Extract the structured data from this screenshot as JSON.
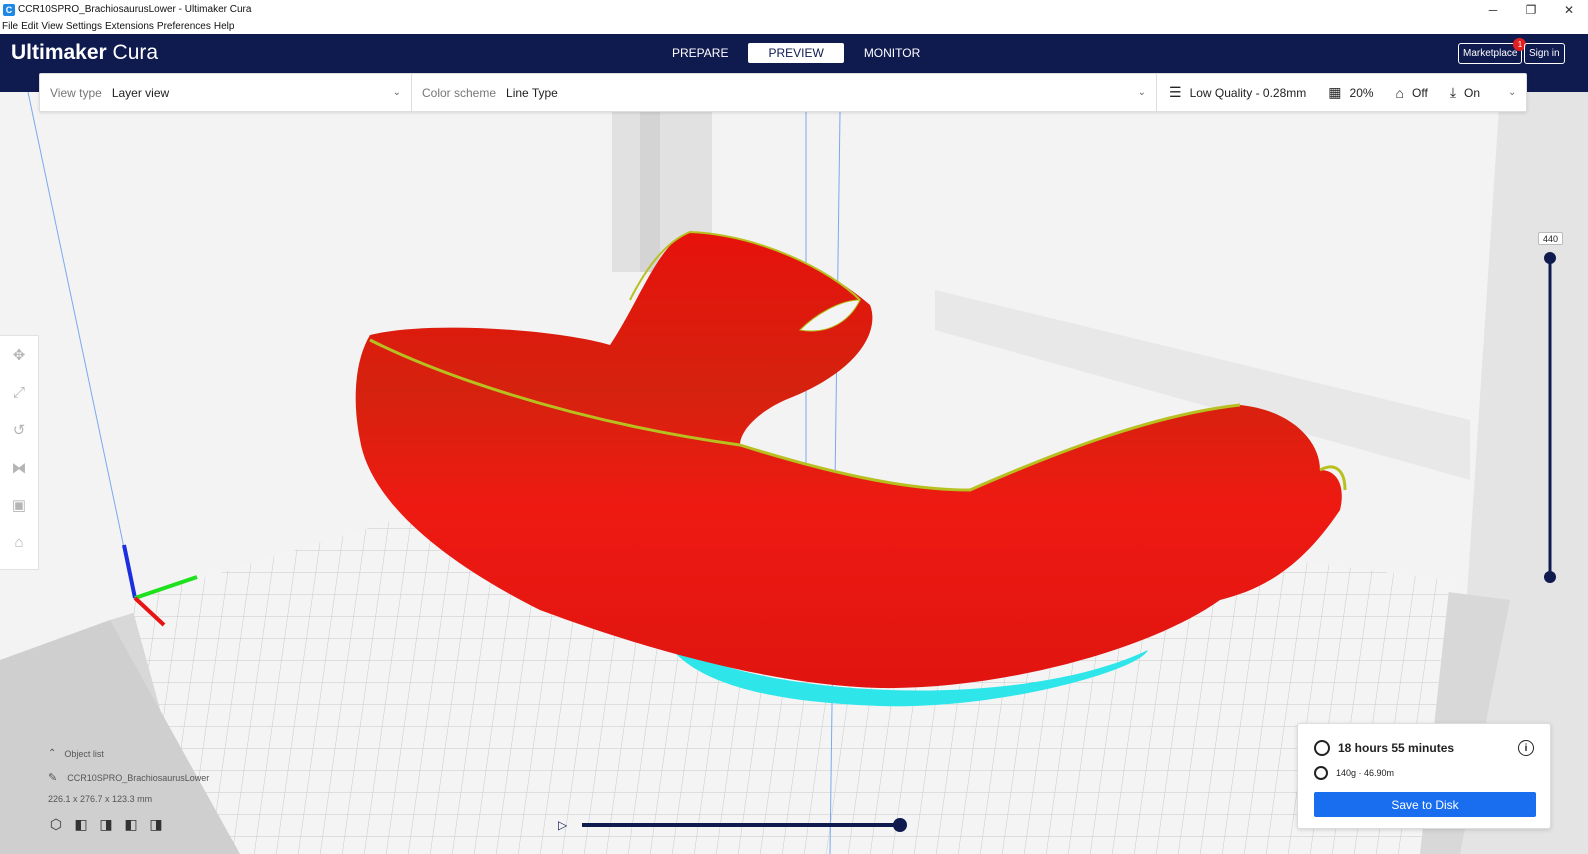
{
  "window": {
    "title": "CCR10SPRO_BrachiosaurusLower - Ultimaker Cura",
    "app_icon_glyph": "C",
    "controls": [
      "─",
      "❐",
      "✕"
    ]
  },
  "menu": [
    "File",
    "Edit",
    "View",
    "Settings",
    "Extensions",
    "Preferences",
    "Help"
  ],
  "header": {
    "brand_bold": "Ultimaker",
    "brand_light": " Cura",
    "stages": [
      {
        "label": "PREPARE",
        "active": false
      },
      {
        "label": "PREVIEW",
        "active": true
      },
      {
        "label": "MONITOR",
        "active": false
      }
    ],
    "marketplace_label": "Marketplace",
    "marketplace_badge": "1",
    "signin_label": "Sign in"
  },
  "toolbar": {
    "view_type_label": "View type",
    "view_type_value": "Layer view",
    "color_scheme_label": "Color scheme",
    "color_scheme_value": "Line Type",
    "quality": "Low Quality - 0.28mm",
    "infill": "20%",
    "support": "Off",
    "adhesion": "On"
  },
  "layer_slider": {
    "top_value": "440"
  },
  "object_list": {
    "header": "Object list",
    "object_name": "CCR10SPRO_BrachiosaurusLower",
    "dimensions": "226.1 x 276.7 x 123.3 mm"
  },
  "print_info": {
    "time": "18 hours 55 minutes",
    "material": "140g · 46.90m",
    "save_label": "Save to Disk"
  },
  "colors": {
    "header_bg": "#0f1a4f",
    "accent_blue": "#196ef0",
    "model_red": "#e8150f",
    "skirt_cyan": "#2ee6ea",
    "wall_yellow": "#b8c020"
  }
}
